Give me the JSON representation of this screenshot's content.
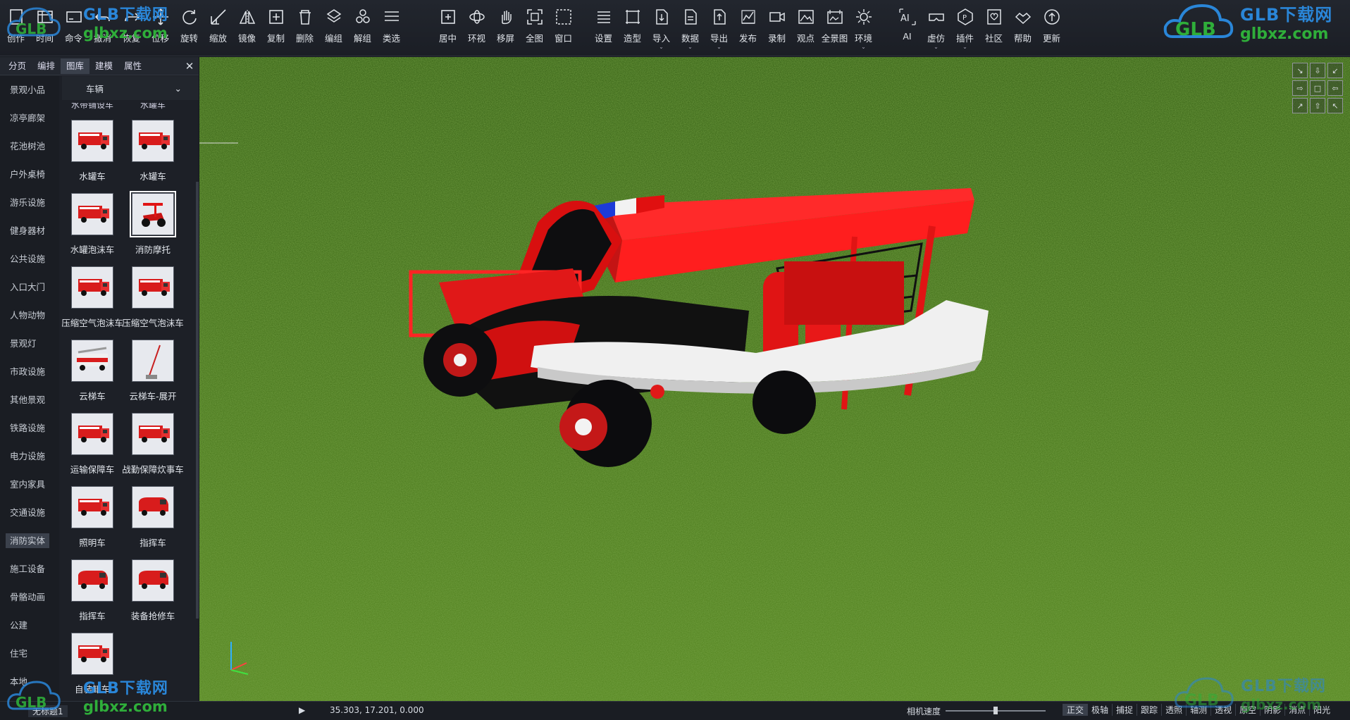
{
  "toolbar": {
    "group1": [
      {
        "label": "创作",
        "icon": "new-file-icon"
      },
      {
        "label": "时间",
        "icon": "clock-icon"
      },
      {
        "label": "命令",
        "icon": "command-icon"
      },
      {
        "label": "撤消",
        "icon": "undo-icon"
      },
      {
        "label": "恢复",
        "icon": "redo-icon"
      },
      {
        "label": "位移",
        "icon": "move-icon"
      },
      {
        "label": "旋转",
        "icon": "rotate-icon"
      },
      {
        "label": "缩放",
        "icon": "scale-icon"
      },
      {
        "label": "镜像",
        "icon": "mirror-icon"
      },
      {
        "label": "复制",
        "icon": "copy-icon"
      },
      {
        "label": "删除",
        "icon": "delete-icon"
      },
      {
        "label": "编组",
        "icon": "group-icon"
      },
      {
        "label": "解组",
        "icon": "ungroup-icon"
      },
      {
        "label": "类选",
        "icon": "select-type-icon"
      }
    ],
    "group2": [
      {
        "label": "居中",
        "icon": "center-icon"
      },
      {
        "label": "环视",
        "icon": "orbit-icon"
      },
      {
        "label": "移屏",
        "icon": "pan-hand-icon"
      },
      {
        "label": "全图",
        "icon": "fit-all-icon"
      },
      {
        "label": "窗口",
        "icon": "window-zoom-icon"
      }
    ],
    "group3": [
      {
        "label": "设置",
        "icon": "settings-icon"
      },
      {
        "label": "造型",
        "icon": "modeling-icon"
      },
      {
        "label": "导入",
        "icon": "import-icon",
        "dropdown": true
      },
      {
        "label": "数据",
        "icon": "data-icon",
        "dropdown": true
      },
      {
        "label": "导出",
        "icon": "export-icon",
        "dropdown": true
      },
      {
        "label": "发布",
        "icon": "publish-icon"
      },
      {
        "label": "录制",
        "icon": "record-icon"
      },
      {
        "label": "观点",
        "icon": "viewpoint-icon"
      },
      {
        "label": "全景图",
        "icon": "panorama-icon"
      },
      {
        "label": "环境",
        "icon": "environment-sun-icon",
        "dropdown": true
      }
    ],
    "group4": [
      {
        "label": "AI",
        "icon": "ai-icon"
      },
      {
        "label": "虚仿",
        "icon": "vr-icon",
        "dropdown": true
      },
      {
        "label": "插件",
        "icon": "plugin-icon",
        "dropdown": true
      },
      {
        "label": "社区",
        "icon": "community-icon"
      },
      {
        "label": "帮助",
        "icon": "help-icon"
      },
      {
        "label": "更新",
        "icon": "update-icon"
      }
    ]
  },
  "watermark": {
    "brand": "GLB下载网",
    "domain": "glbxz.com",
    "logo": "GLB"
  },
  "panel": {
    "tabs": [
      "分页",
      "编排",
      "图库",
      "建模",
      "属性"
    ],
    "active_tab": "图库",
    "close": "✕",
    "categories": [
      "景观小品",
      "凉亭廊架",
      "花池树池",
      "户外桌椅",
      "游乐设施",
      "健身器材",
      "公共设施",
      "入口大门",
      "人物动物",
      "景观灯",
      "市政设施",
      "其他景观",
      "铁路设施",
      "电力设施",
      "室内家具",
      "交通设施",
      "消防实体",
      "施工设备",
      "骨骼动画",
      "公建",
      "住宅",
      "本地"
    ],
    "active_category": "消防实体",
    "library_select": "车辆",
    "library_select_arrow": "⌄",
    "partial_row": [
      "水带铺设车",
      "水罐车"
    ],
    "items": [
      {
        "name": "水罐车",
        "thumb": "fire-truck"
      },
      {
        "name": "水罐车",
        "thumb": "fire-truck"
      },
      {
        "name": "水罐泡沫车",
        "thumb": "fire-truck"
      },
      {
        "name": "消防摩托",
        "thumb": "fire-atv",
        "selected": true
      },
      {
        "name": "压缩空气泡沫车",
        "thumb": "fire-truck"
      },
      {
        "name": "压缩空气泡沫车",
        "thumb": "fire-truck"
      },
      {
        "name": "云梯车",
        "thumb": "ladder-truck"
      },
      {
        "name": "云梯车-展开",
        "thumb": "ladder-extended"
      },
      {
        "name": "运输保障车",
        "thumb": "fire-truck"
      },
      {
        "name": "战勤保障炊事车",
        "thumb": "fire-truck"
      },
      {
        "name": "照明车",
        "thumb": "fire-truck"
      },
      {
        "name": "指挥车",
        "thumb": "fire-van"
      },
      {
        "name": "指挥车",
        "thumb": "fire-van"
      },
      {
        "name": "装备抢修车",
        "thumb": "fire-van"
      },
      {
        "name": "自装卸车",
        "thumb": "fire-truck"
      }
    ]
  },
  "navcube": [
    "↘",
    "⇩",
    "↙",
    "⇨",
    "□",
    "⇦",
    "↗",
    "⇧",
    "↖"
  ],
  "status": {
    "tab_label": "无标题1",
    "play_icon": "▶",
    "coords": "35.303, 17.201, 0.000",
    "camera_speed_label": "相机速度",
    "camera_speed_level": 0.5,
    "buttons": [
      "正交",
      "极轴",
      "捕捉",
      "跟踪",
      "透照",
      "轴测",
      "透视",
      "原空",
      "阴影",
      "消点",
      "阳光"
    ]
  },
  "colors": {
    "accent": "#e0191c",
    "grass": "#4f7a22",
    "panel": "#1d2027",
    "brand_blue": "#2a86d8",
    "brand_green": "#2fae3a"
  }
}
